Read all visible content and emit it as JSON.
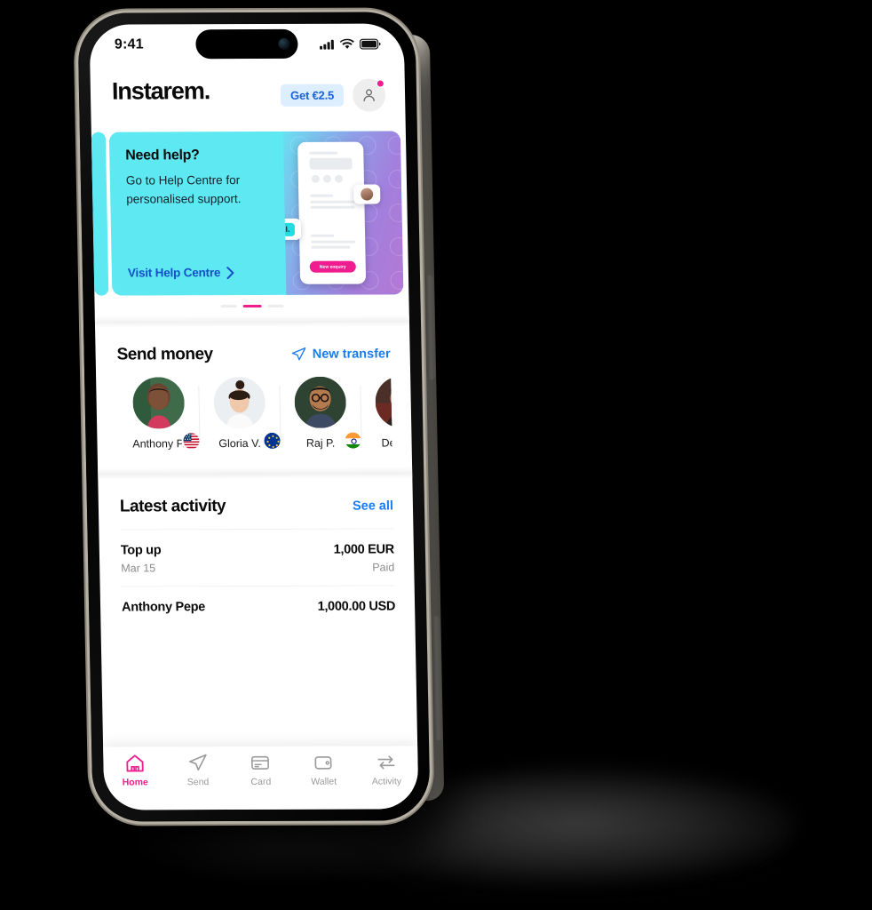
{
  "status_bar": {
    "time": "9:41",
    "icons": [
      "signal-icon",
      "wifi-icon",
      "battery-icon"
    ]
  },
  "header": {
    "logo": "Instarem.",
    "promo_pill": "Get €2.5",
    "avatar_icon": "person-icon",
    "has_notification": true
  },
  "banner": {
    "title": "Need help?",
    "body": "Go to Help Centre for personalised support.",
    "cta": "Visit Help Centre",
    "cta_icon": "chevron-right-icon",
    "mock_button": "New enquiry",
    "mock_logo": "I.",
    "colors": {
      "bg": "#5ee9f2",
      "accent": "#1450c8",
      "gradient_end": "#b478d4",
      "pink": "#ef1d8f"
    }
  },
  "carousel": {
    "dot_count": 3,
    "active_index": 1
  },
  "send_money": {
    "title": "Send money",
    "action_label": "New transfer",
    "action_icon": "paper-plane-icon",
    "contacts": [
      {
        "name": "Anthony P.",
        "flag": "us-flag-icon"
      },
      {
        "name": "Gloria V.",
        "flag": "eu-flag-icon"
      },
      {
        "name": "Raj P.",
        "flag": "in-flag-icon"
      },
      {
        "name": "Dean K.",
        "flag": "hk-flag-icon"
      }
    ]
  },
  "latest_activity": {
    "title": "Latest activity",
    "action_label": "See all",
    "rows": [
      {
        "title": "Top up",
        "subtitle": "Mar 15",
        "amount": "1,000 EUR",
        "status": "Paid"
      },
      {
        "title": "Anthony Pepe",
        "subtitle": "",
        "amount": "1,000.00 USD",
        "status": ""
      }
    ]
  },
  "tabbar": {
    "items": [
      {
        "label": "Home",
        "icon": "home-icon",
        "active": true
      },
      {
        "label": "Send",
        "icon": "paper-plane-icon",
        "active": false
      },
      {
        "label": "Card",
        "icon": "card-icon",
        "active": false
      },
      {
        "label": "Wallet",
        "icon": "wallet-icon",
        "active": false
      },
      {
        "label": "Activity",
        "icon": "exchange-arrows-icon",
        "active": false
      }
    ],
    "active_color": "#ef1d8f",
    "inactive_color": "#9a9a9a"
  }
}
